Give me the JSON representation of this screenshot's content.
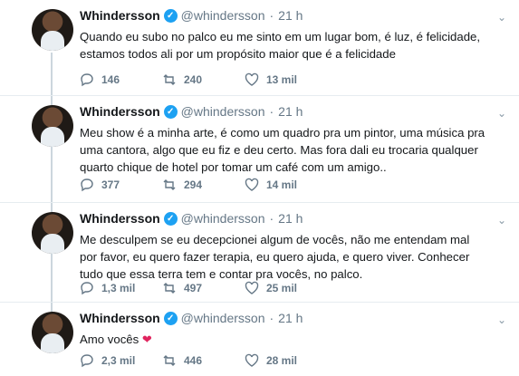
{
  "tweets": [
    {
      "name": "Whindersson",
      "handle": "@whindersson",
      "time": "21 h",
      "text": "Quando eu subo no palco eu me sinto em um lugar bom, é luz, é felicidade, estamos todos ali por um propósito maior que é a felicidade",
      "replies": "146",
      "retweets": "240",
      "likes": "13 mil"
    },
    {
      "name": "Whindersson",
      "handle": "@whindersson",
      "time": "21 h",
      "text": "Meu show é a minha arte, é como um quadro pra um pintor, uma música pra uma cantora, algo que eu fiz e deu certo. Mas fora dali eu trocaria qualquer quarto chique de hotel por tomar um café com um amigo..",
      "replies": "377",
      "retweets": "294",
      "likes": "14 mil"
    },
    {
      "name": "Whindersson",
      "handle": "@whindersson",
      "time": "21 h",
      "text": "Me desculpem se eu decepcionei algum de vocês, não me entendam mal por favor, eu quero fazer terapia, eu quero ajuda, e quero viver. Conhecer tudo que essa terra tem e contar pra vocês, no palco.",
      "replies": "1,3 mil",
      "retweets": "497",
      "likes": "25 mil"
    },
    {
      "name": "Whindersson",
      "handle": "@whindersson",
      "time": "21 h",
      "text": "Amo vocês",
      "heart": "❤",
      "replies": "2,3 mil",
      "retweets": "446",
      "likes": "28 mil"
    }
  ],
  "icons": {
    "reply": "reply-icon",
    "retweet": "retweet-icon",
    "like": "like-icon",
    "verified": "verified-badge-icon",
    "more": "chevron-down-icon"
  },
  "colors": {
    "verified": "#1da1f2",
    "heart": "#e0245e",
    "muted": "#657786",
    "thread": "#ccd6dd"
  }
}
